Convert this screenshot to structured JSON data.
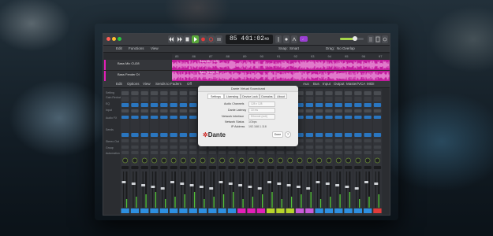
{
  "window": {
    "lcd": {
      "bar": "85 4",
      "time": "01:02",
      "time_frac": "49"
    },
    "menus_top": [
      "Edit",
      "Functions",
      "View"
    ],
    "menus_tracks": [
      "Edit",
      "Options",
      "View",
      "Sends to Faders",
      "Off"
    ],
    "snap_label": "Snap:",
    "snap_value": "Smart",
    "drag_label": "Drag:",
    "drag_value": "No Overlap",
    "mixer_right_tabs": [
      "Aux",
      "Bus",
      "Input",
      "Output",
      "Master/VCA",
      "MIDI"
    ],
    "ruler": [
      "85",
      "86",
      "87",
      "88",
      "89",
      "90",
      "91",
      "92",
      "93",
      "94",
      "95",
      "96",
      "97"
    ],
    "tracks": [
      {
        "name": "Bass Mic CU28",
        "region": "Bass Mic CU28"
      },
      {
        "name": "Bass Fender DI",
        "region": "Bass Fender DI"
      }
    ],
    "mixer_row_labels": [
      "Setting",
      "Gain Reduction",
      "EQ",
      "Input",
      "Audio FX",
      "Sends",
      "Stereo Out",
      "Group",
      "Automation"
    ],
    "accent_pink": "#c21d9e",
    "accent_purple": "#9b3fd2"
  },
  "dialog": {
    "title": "Dante Virtual Soundcard",
    "tabs": [
      "Settings",
      "Licensing",
      "Device Lock",
      "Domains",
      "About"
    ],
    "fields": [
      {
        "label": "Audio Channels",
        "value": "128 x 128"
      },
      {
        "label": "Dante Latency",
        "value": "10 ms"
      },
      {
        "label": "Network Interface",
        "value": "Ethernet (en6)"
      },
      {
        "label": "Network Status",
        "value": "1Gbps"
      },
      {
        "label": "IP Address",
        "value": "192.168.1.118"
      }
    ],
    "logo": "Dante",
    "done": "Done",
    "help": "?"
  }
}
